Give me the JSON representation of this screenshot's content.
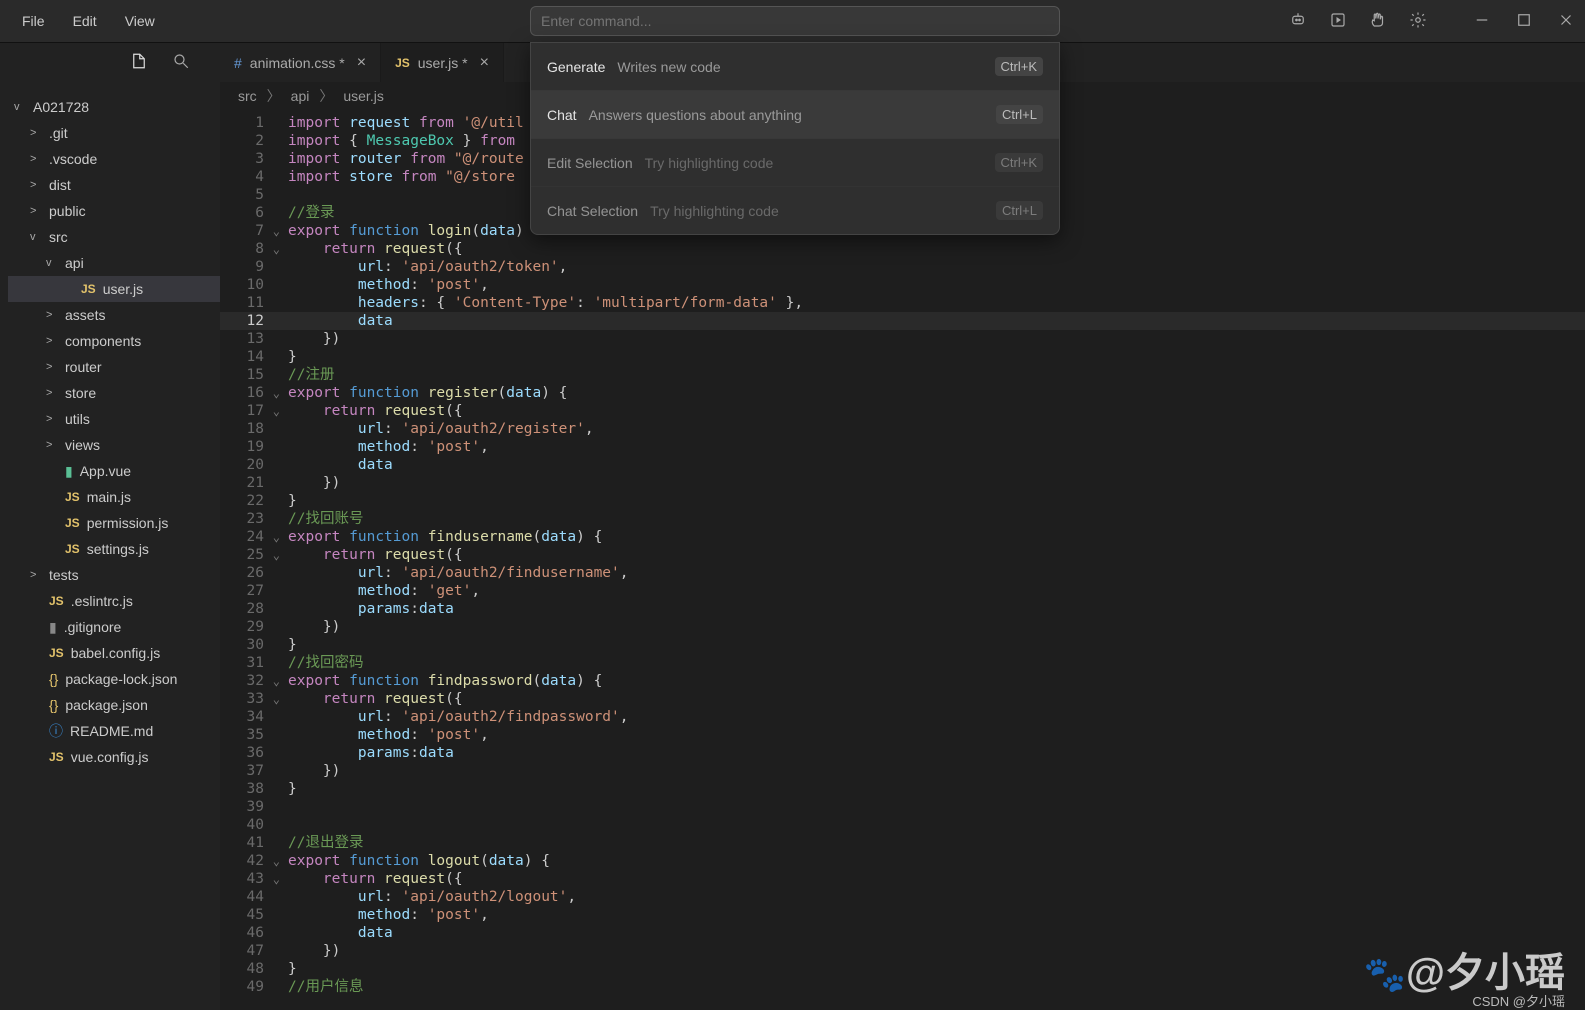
{
  "menubar": {
    "items": [
      "File",
      "Edit",
      "View"
    ]
  },
  "command_input": {
    "placeholder": "Enter command..."
  },
  "title_icons": [
    "ai-icon",
    "run-icon",
    "hand-icon",
    "gear-icon"
  ],
  "tabs": [
    {
      "icon": "icon-css",
      "iconText": "#",
      "label": "animation.css",
      "dirty": true,
      "active": false
    },
    {
      "icon": "icon-js",
      "iconText": "JS",
      "label": "user.js",
      "dirty": true,
      "active": true
    }
  ],
  "breadcrumb": [
    "src",
    "api",
    "user.js"
  ],
  "explorer": {
    "root": {
      "label": "A021728",
      "expanded": true
    },
    "items": [
      {
        "ind": 1,
        "chev": ">",
        "icon": "",
        "label": ".git"
      },
      {
        "ind": 1,
        "chev": ">",
        "icon": "",
        "label": ".vscode"
      },
      {
        "ind": 1,
        "chev": ">",
        "icon": "",
        "label": "dist"
      },
      {
        "ind": 1,
        "chev": ">",
        "icon": "",
        "label": "public"
      },
      {
        "ind": 1,
        "chev": "v",
        "icon": "",
        "label": "src"
      },
      {
        "ind": 2,
        "chev": "v",
        "icon": "",
        "label": "api"
      },
      {
        "ind": 3,
        "chev": "",
        "icon": "icon-js",
        "iconText": "JS",
        "label": "user.js",
        "sel": true
      },
      {
        "ind": 2,
        "chev": ">",
        "icon": "",
        "label": "assets"
      },
      {
        "ind": 2,
        "chev": ">",
        "icon": "",
        "label": "components"
      },
      {
        "ind": 2,
        "chev": ">",
        "icon": "",
        "label": "router"
      },
      {
        "ind": 2,
        "chev": ">",
        "icon": "",
        "label": "store"
      },
      {
        "ind": 2,
        "chev": ">",
        "icon": "",
        "label": "utils"
      },
      {
        "ind": 2,
        "chev": ">",
        "icon": "",
        "label": "views"
      },
      {
        "ind": 2,
        "chev": "",
        "icon": "icon-vue",
        "iconText": "▮",
        "label": "App.vue"
      },
      {
        "ind": 2,
        "chev": "",
        "icon": "icon-js",
        "iconText": "JS",
        "label": "main.js"
      },
      {
        "ind": 2,
        "chev": "",
        "icon": "icon-js",
        "iconText": "JS",
        "label": "permission.js"
      },
      {
        "ind": 2,
        "chev": "",
        "icon": "icon-js",
        "iconText": "JS",
        "label": "settings.js"
      },
      {
        "ind": 1,
        "chev": ">",
        "icon": "",
        "label": "tests"
      },
      {
        "ind": 1,
        "chev": "",
        "icon": "icon-js",
        "iconText": "JS",
        "label": ".eslintrc.js"
      },
      {
        "ind": 1,
        "chev": "",
        "icon": "icon-file",
        "iconText": "▮",
        "label": ".gitignore"
      },
      {
        "ind": 1,
        "chev": "",
        "icon": "icon-js",
        "iconText": "JS",
        "label": "babel.config.js"
      },
      {
        "ind": 1,
        "chev": "",
        "icon": "icon-json",
        "iconText": "{}",
        "label": "package-lock.json"
      },
      {
        "ind": 1,
        "chev": "",
        "icon": "icon-json",
        "iconText": "{}",
        "label": "package.json"
      },
      {
        "ind": 1,
        "chev": "",
        "icon": "icon-info",
        "iconText": "ⓘ",
        "label": "README.md"
      },
      {
        "ind": 1,
        "chev": "",
        "icon": "icon-js",
        "iconText": "JS",
        "label": "vue.config.js"
      }
    ]
  },
  "popup": {
    "rows": [
      {
        "title": "Generate",
        "desc": "Writes new code",
        "key": "Ctrl+K",
        "state": "normal"
      },
      {
        "title": "Chat",
        "desc": "Answers questions about anything",
        "key": "Ctrl+L",
        "state": "sel"
      },
      {
        "title": "Edit Selection",
        "desc": "Try highlighting code",
        "key": "Ctrl+K",
        "state": "disabled"
      },
      {
        "title": "Chat Selection",
        "desc": "Try highlighting code",
        "key": "Ctrl+L",
        "state": "disabled"
      }
    ]
  },
  "code": {
    "current_line": 12,
    "foldable_lines": [
      7,
      8,
      16,
      17,
      24,
      25,
      32,
      33,
      42,
      43
    ],
    "lines": [
      {
        "n": 1,
        "html": "<span class='tk-kw2'>import</span> <span class='tk-prop'>request</span> <span class='tk-kw2'>from</span> <span class='tk-str'>'@/util</span>"
      },
      {
        "n": 2,
        "html": "<span class='tk-kw2'>import</span> { <span class='tk-type'>MessageBox</span> } <span class='tk-kw2'>from</span>"
      },
      {
        "n": 3,
        "html": "<span class='tk-kw2'>import</span> <span class='tk-prop'>router</span> <span class='tk-kw2'>from</span> <span class='tk-str'>\"@/route</span>"
      },
      {
        "n": 4,
        "html": "<span class='tk-kw2'>import</span> <span class='tk-prop'>store</span> <span class='tk-kw2'>from</span> <span class='tk-str'>\"@/store</span>"
      },
      {
        "n": 5,
        "html": ""
      },
      {
        "n": 6,
        "html": "<span class='tk-com'>//登录</span>"
      },
      {
        "n": 7,
        "html": "<span class='tk-kw2'>export</span> <span class='tk-kw'>function</span> <span class='tk-fn'>login</span>(<span class='tk-prop'>data</span>) "
      },
      {
        "n": 8,
        "html": "    <span class='tk-kw2'>return</span> <span class='tk-fn'>request</span>({"
      },
      {
        "n": 9,
        "html": "        <span class='tk-prop'>url</span>: <span class='tk-str'>'api/oauth2/token'</span>,"
      },
      {
        "n": 10,
        "html": "        <span class='tk-prop'>method</span>: <span class='tk-str'>'post'</span>,"
      },
      {
        "n": 11,
        "html": "        <span class='tk-prop'>headers</span>: { <span class='tk-str'>'Content-Type'</span>: <span class='tk-str'>'multipart/form-data'</span> },"
      },
      {
        "n": 12,
        "html": "        <span class='tk-prop'>data</span>"
      },
      {
        "n": 13,
        "html": "    })"
      },
      {
        "n": 14,
        "html": "}"
      },
      {
        "n": 15,
        "html": "<span class='tk-com'>//注册</span>"
      },
      {
        "n": 16,
        "html": "<span class='tk-kw2'>export</span> <span class='tk-kw'>function</span> <span class='tk-fn'>register</span>(<span class='tk-prop'>data</span>) {"
      },
      {
        "n": 17,
        "html": "    <span class='tk-kw2'>return</span> <span class='tk-fn'>request</span>({"
      },
      {
        "n": 18,
        "html": "        <span class='tk-prop'>url</span>: <span class='tk-str'>'api/oauth2/register'</span>,"
      },
      {
        "n": 19,
        "html": "        <span class='tk-prop'>method</span>: <span class='tk-str'>'post'</span>,"
      },
      {
        "n": 20,
        "html": "        <span class='tk-prop'>data</span>"
      },
      {
        "n": 21,
        "html": "    })"
      },
      {
        "n": 22,
        "html": "}"
      },
      {
        "n": 23,
        "html": "<span class='tk-com'>//找回账号</span>"
      },
      {
        "n": 24,
        "html": "<span class='tk-kw2'>export</span> <span class='tk-kw'>function</span> <span class='tk-fn'>findusername</span>(<span class='tk-prop'>data</span>) {"
      },
      {
        "n": 25,
        "html": "    <span class='tk-kw2'>return</span> <span class='tk-fn'>request</span>({"
      },
      {
        "n": 26,
        "html": "        <span class='tk-prop'>url</span>: <span class='tk-str'>'api/oauth2/findusername'</span>,"
      },
      {
        "n": 27,
        "html": "        <span class='tk-prop'>method</span>: <span class='tk-str'>'get'</span>,"
      },
      {
        "n": 28,
        "html": "        <span class='tk-prop'>params</span>:<span class='tk-prop'>data</span>"
      },
      {
        "n": 29,
        "html": "    })"
      },
      {
        "n": 30,
        "html": "}"
      },
      {
        "n": 31,
        "html": "<span class='tk-com'>//找回密码</span>"
      },
      {
        "n": 32,
        "html": "<span class='tk-kw2'>export</span> <span class='tk-kw'>function</span> <span class='tk-fn'>findpassword</span>(<span class='tk-prop'>data</span>) {"
      },
      {
        "n": 33,
        "html": "    <span class='tk-kw2'>return</span> <span class='tk-fn'>request</span>({"
      },
      {
        "n": 34,
        "html": "        <span class='tk-prop'>url</span>: <span class='tk-str'>'api/oauth2/findpassword'</span>,"
      },
      {
        "n": 35,
        "html": "        <span class='tk-prop'>method</span>: <span class='tk-str'>'post'</span>,"
      },
      {
        "n": 36,
        "html": "        <span class='tk-prop'>params</span>:<span class='tk-prop'>data</span>"
      },
      {
        "n": 37,
        "html": "    })"
      },
      {
        "n": 38,
        "html": "}"
      },
      {
        "n": 39,
        "html": ""
      },
      {
        "n": 40,
        "html": ""
      },
      {
        "n": 41,
        "html": "<span class='tk-com'>//退出登录</span>"
      },
      {
        "n": 42,
        "html": "<span class='tk-kw2'>export</span> <span class='tk-kw'>function</span> <span class='tk-fn'>logout</span>(<span class='tk-prop'>data</span>) {"
      },
      {
        "n": 43,
        "html": "    <span class='tk-kw2'>return</span> <span class='tk-fn'>request</span>({"
      },
      {
        "n": 44,
        "html": "        <span class='tk-prop'>url</span>: <span class='tk-str'>'api/oauth2/logout'</span>,"
      },
      {
        "n": 45,
        "html": "        <span class='tk-prop'>method</span>: <span class='tk-str'>'post'</span>,"
      },
      {
        "n": 46,
        "html": "        <span class='tk-prop'>data</span>"
      },
      {
        "n": 47,
        "html": "    })"
      },
      {
        "n": 48,
        "html": "}"
      },
      {
        "n": 49,
        "html": "<span class='tk-com'>//用户信息</span>"
      }
    ]
  },
  "watermark": {
    "main": "@夕小瑶",
    "sub": "CSDN @夕小瑶"
  }
}
